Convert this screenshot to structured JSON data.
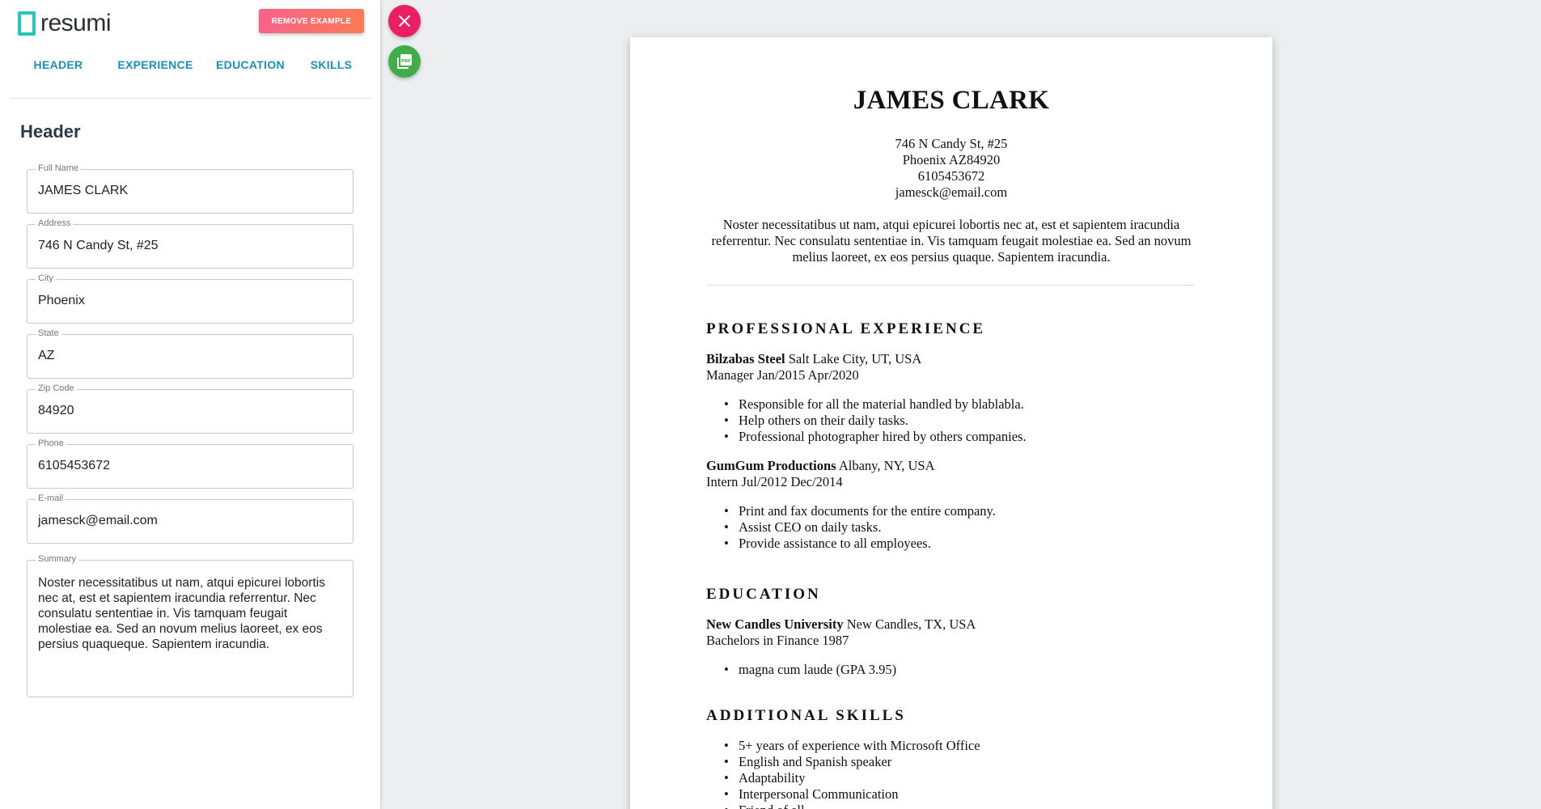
{
  "app": {
    "logo_text": "resumi",
    "remove_button": "REMOVE EXAMPLE"
  },
  "tabs": [
    "HEADER",
    "EXPERIENCE",
    "EDUCATION",
    "SKILLS"
  ],
  "form": {
    "section_title": "Header",
    "fields": [
      {
        "label": "Full Name",
        "value": "JAMES CLARK"
      },
      {
        "label": "Address",
        "value": "746 N Candy St, #25"
      },
      {
        "label": "City",
        "value": "Phoenix"
      },
      {
        "label": "State",
        "value": "AZ"
      },
      {
        "label": "Zip Code",
        "value": "84920"
      },
      {
        "label": "Phone",
        "value": "6105453672"
      },
      {
        "label": "E-mail",
        "value": "jamesck@email.com"
      },
      {
        "label": "Summary",
        "value": "Noster necessitatibus ut nam, atqui epicurei lobortis nec at, est et sapientem iracundia referrentur. Nec consulatu sententiae in. Vis tamquam feugait molestiae ea. Sed an novum melius laoreet, ex eos persius quaqueque. Sapientem iracundia."
      }
    ]
  },
  "icons": {
    "close": "close-icon",
    "pdf": "pdf-icon"
  },
  "colors": {
    "accent": "#1b8fbc",
    "close_fab": "#e91e63",
    "pdf_fab": "#3fae49",
    "logo": "#26c6b7"
  },
  "resume": {
    "name": "JAMES CLARK",
    "contact": [
      "746 N Candy St, #25",
      "Phoenix AZ84920",
      "6105453672",
      "jamesck@email.com"
    ],
    "summary": "Noster necessitatibus ut nam, atqui epicurei lobortis nec at, est et sapientem iracundia referrentur. Nec consulatu sententiae in. Vis tamquam feugait molestiae ea. Sed an novum melius laoreet, ex eos persius quaque. Sapientem iracundia.",
    "experience": {
      "heading": "PROFESSIONAL EXPERIENCE",
      "jobs": [
        {
          "company": "Bilzabas Steel",
          "location": "Salt Lake City, UT, USA",
          "role": "Manager Jan/2015 Apr/2020",
          "bullets": [
            "Responsible for all the material handled by blablabla.",
            "Help others on their daily tasks.",
            "Professional photographer hired by others companies."
          ]
        },
        {
          "company": "GumGum Productions",
          "location": "Albany, NY, USA",
          "role": "Intern Jul/2012 Dec/2014",
          "bullets": [
            "Print and fax documents for the entire company.",
            "Assist CEO on daily tasks.",
            "Provide assistance to all employees."
          ]
        }
      ]
    },
    "education": {
      "heading": "EDUCATION",
      "school": "New Candles University",
      "location": "New Candles, TX, USA",
      "degree": "Bachelors in Finance 1987",
      "bullets": [
        "magna cum laude (GPA 3.95)"
      ]
    },
    "skills": {
      "heading": "ADDITIONAL SKILLS",
      "items": [
        "5+ years of experience with Microsoft Office",
        "English and Spanish speaker",
        "Adaptability",
        "Interpersonal Communication",
        "Friend of all"
      ]
    }
  }
}
